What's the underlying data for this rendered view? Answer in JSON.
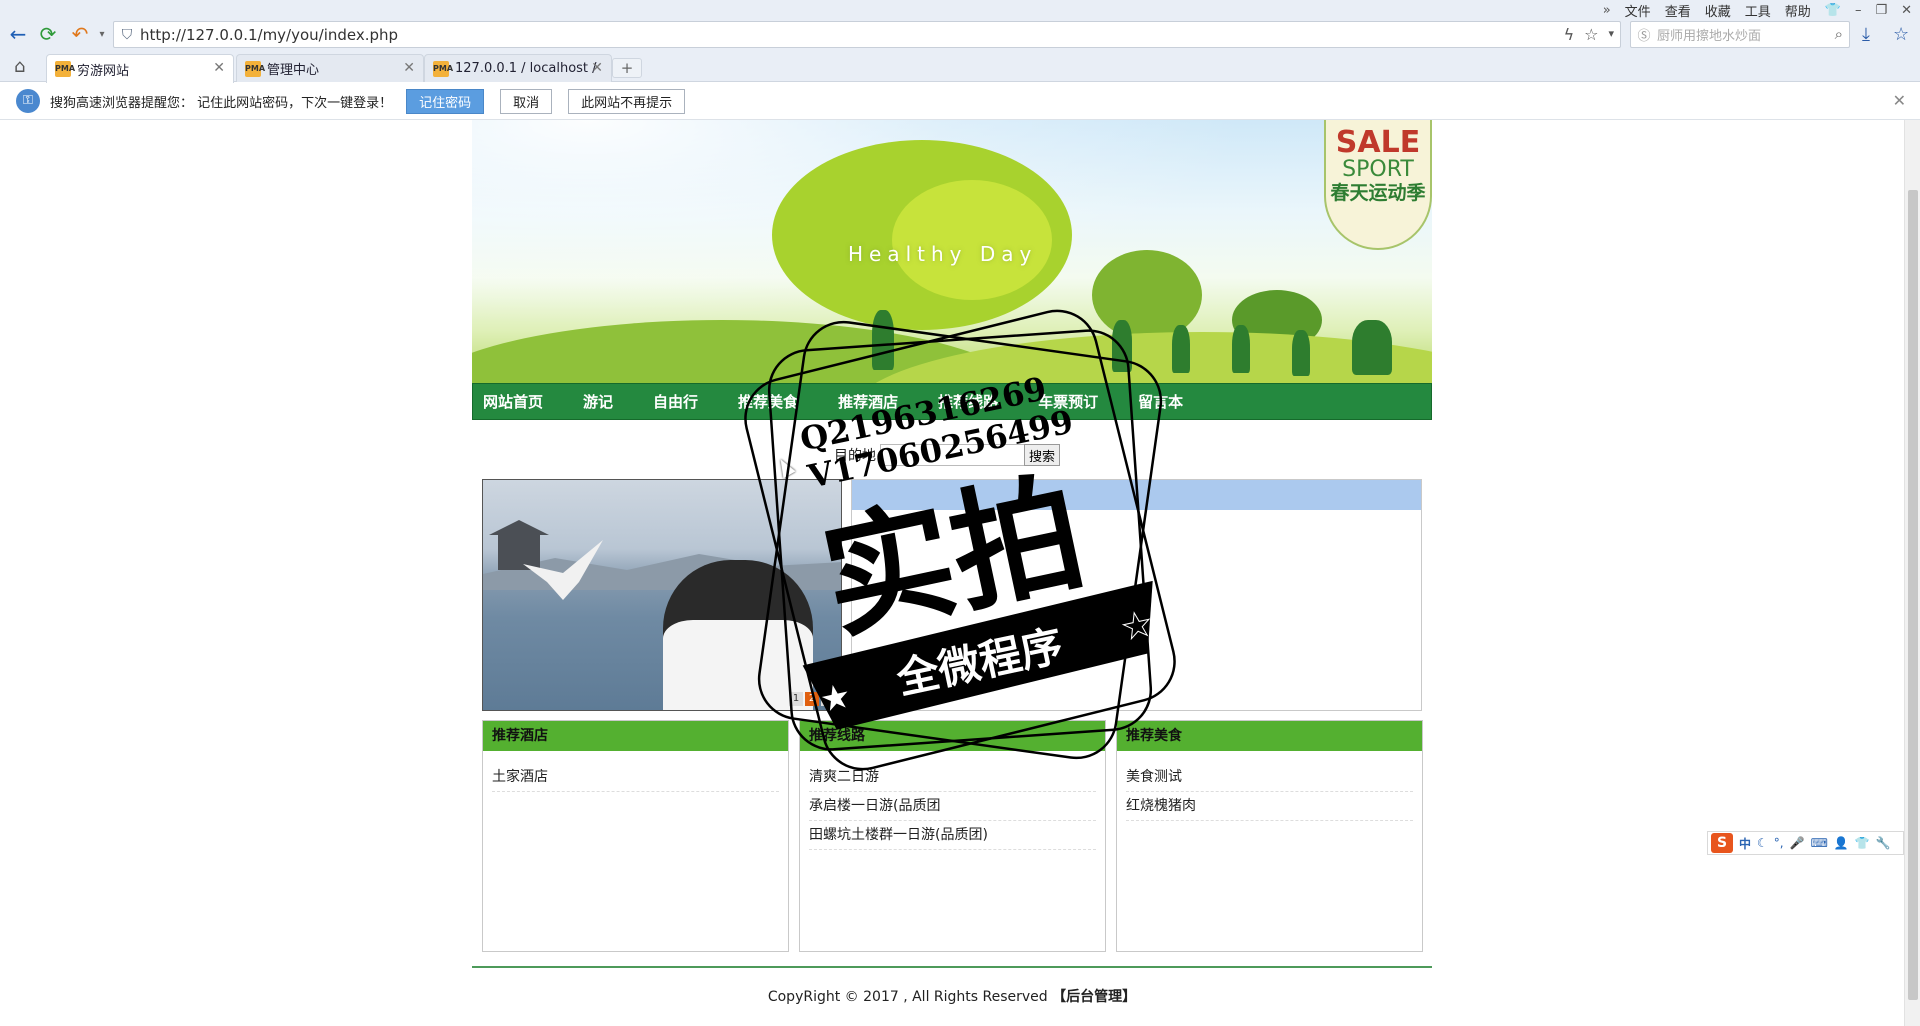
{
  "browser": {
    "menu": [
      "文件",
      "查看",
      "收藏",
      "工具",
      "帮助"
    ],
    "url": "http://127.0.0.1/my/you/index.php",
    "search_placeholder": "厨师用擦地水炒面",
    "tabs": [
      {
        "label": "穷游网站",
        "active": true
      },
      {
        "label": "管理中心",
        "active": false
      },
      {
        "label": "127.0.0.1 / localhost / ",
        "active": false
      }
    ],
    "newtab_label": "+",
    "password_bar": {
      "message": "搜狗高速浏览器提醒您： 记住此网站密码，下次一键登录！",
      "remember": "记住密码",
      "cancel": "取消",
      "never": "此网站不再提示"
    }
  },
  "banner": {
    "tagline": "Healthy Day",
    "seal_sale": "SALE",
    "seal_sport": "SPORT",
    "seal_cn": "春天运动季"
  },
  "nav": [
    "网站首页",
    "游记",
    "自由行",
    "推荐美食",
    "推荐酒店",
    "推荐线路",
    "车票预订",
    "留言本"
  ],
  "search": {
    "label": "目的地",
    "button": "搜索"
  },
  "slider": {
    "pages": [
      "1",
      "2",
      "3"
    ],
    "active": 2
  },
  "sections": [
    {
      "title": "推荐酒店",
      "items": [
        "土家酒店"
      ]
    },
    {
      "title": "推荐线路",
      "items": [
        "清爽二日游",
        "承启楼一日游(品质团",
        "田螺坑土楼群一日游(品质团)"
      ]
    },
    {
      "title": "推荐美食",
      "items": [
        "美食测试",
        "红烧槐猪肉"
      ]
    }
  ],
  "footer": {
    "text": "CopyRight © 2017 , All Rights Reserved ",
    "admin": "【后台管理】"
  },
  "ime": {
    "logo": "S",
    "mode": "中"
  },
  "watermark": {
    "line1": "Q2196316269",
    "line2": "V17060256499",
    "big": "实拍",
    "banner": "全微程序"
  },
  "colors": {
    "nav_green": "#24893f",
    "section_green": "#54b030",
    "news_blue": "#abc9ee",
    "primary_button": "#5b9de0"
  }
}
